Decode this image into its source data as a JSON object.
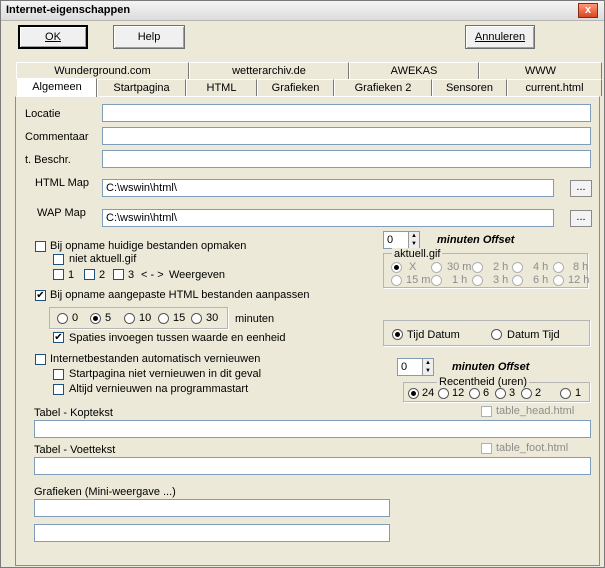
{
  "window": {
    "title": "Internet-eigenschappen",
    "close": "x"
  },
  "buttons": {
    "ok": "OK",
    "help": "Help",
    "cancel": "Annuleren"
  },
  "tabs_row1": [
    "Wunderground.com",
    "wetterarchiv.de",
    "AWEKAS",
    "WWW"
  ],
  "tabs_row2": [
    "Algemeen",
    "Startpagina",
    "HTML",
    "Grafieken",
    "Grafieken 2",
    "Sensoren",
    "current.html"
  ],
  "fields": {
    "locatie_label": "Locatie",
    "commentaar_label": "Commentaar",
    "beschr_label": "t. Beschr.",
    "html_map_label": "HTML Map",
    "html_map_value": "C:\\wswin\\html\\",
    "wap_map_label": "WAP Map",
    "wap_map_value": "C:\\wswin\\html\\",
    "dots": "..."
  },
  "checks": {
    "opname_huidige": "Bij opname huidige bestanden opmaken",
    "niet_aktuell": "niet aktuell.gif",
    "n1": "1",
    "n2": "2",
    "n3": "3",
    "arrows": "< - >",
    "weergeven": "Weergeven",
    "opname_html": "Bij opname aangepaste HTML bestanden aanpassen",
    "spaties": "Spaties invoegen tussen waarde en eenheid",
    "internetbestanden": "Internetbestanden automatisch vernieuwen",
    "startpagina": "Startpagina niet vernieuwen in dit geval",
    "altijd": "Altijd vernieuwen na programmastart",
    "table_head": "table_head.html",
    "table_foot": "table_foot.html"
  },
  "offset1": {
    "value": "0",
    "label": "minuten Offset"
  },
  "aktuell": {
    "title": "aktuell.gif",
    "row1": [
      "X",
      "30 m",
      "2 h",
      "4 h",
      "8 h"
    ],
    "row2": [
      "15 m",
      "1 h",
      "3 h",
      "6 h",
      "12 h"
    ]
  },
  "minutes": {
    "options": [
      "0",
      "5",
      "10",
      "15",
      "30"
    ],
    "selected": "5",
    "suffix": "minuten"
  },
  "tijd": {
    "opt1": "Tijd Datum",
    "opt2": "Datum Tijd",
    "selected": "Tijd Datum"
  },
  "offset2": {
    "value": "0",
    "label": "minuten Offset"
  },
  "recentheid": {
    "title": "Recentheid (uren)",
    "options": [
      "24",
      "12",
      "6",
      "3",
      "2",
      "1"
    ],
    "selected": "24"
  },
  "tabel": {
    "kop_label": "Tabel - Koptekst",
    "voet_label": "Tabel - Voettekst",
    "grafieken_label": "Grafieken (Mini-weergave ...)"
  }
}
